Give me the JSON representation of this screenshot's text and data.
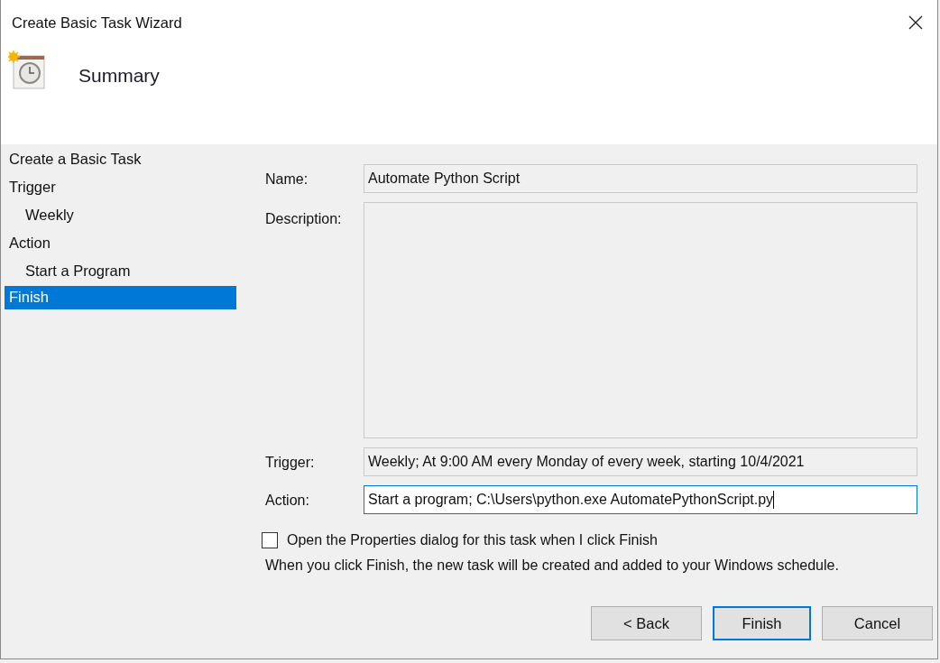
{
  "window": {
    "title": "Create Basic Task Wizard"
  },
  "header": {
    "title": "Summary"
  },
  "sidebar": {
    "items": [
      {
        "label": "Create a Basic Task",
        "selected": false
      },
      {
        "label": "Trigger",
        "selected": false,
        "children": [
          {
            "label": "Weekly",
            "selected": false
          }
        ]
      },
      {
        "label": "Action",
        "selected": false,
        "children": [
          {
            "label": "Start a Program",
            "selected": false
          }
        ]
      },
      {
        "label": "Finish",
        "selected": true
      }
    ]
  },
  "fields": [
    {
      "label": "Name:",
      "kind": "line",
      "value": "Automate Python Script",
      "focused": false
    },
    {
      "label": "Description:",
      "kind": "area",
      "focused": false
    },
    {
      "label": "Trigger:",
      "kind": "line",
      "value": "Weekly; At 9:00 AM every Monday of every week, starting 10/4/2021",
      "focused": false
    },
    {
      "label": "Action:",
      "kind": "line",
      "value": "Start a program; C:\\Users\\python.exe AutomatePythonScript.py",
      "focused": true
    }
  ],
  "checkbox": {
    "label": "Open the Properties dialog for this task when I click Finish",
    "checked": false
  },
  "note": "When you click Finish, the new task will be created and added to your Windows schedule.",
  "buttons": [
    {
      "label": "< Back",
      "default": false
    },
    {
      "label": "Finish",
      "default": true
    },
    {
      "label": "Cancel",
      "default": false
    }
  ]
}
